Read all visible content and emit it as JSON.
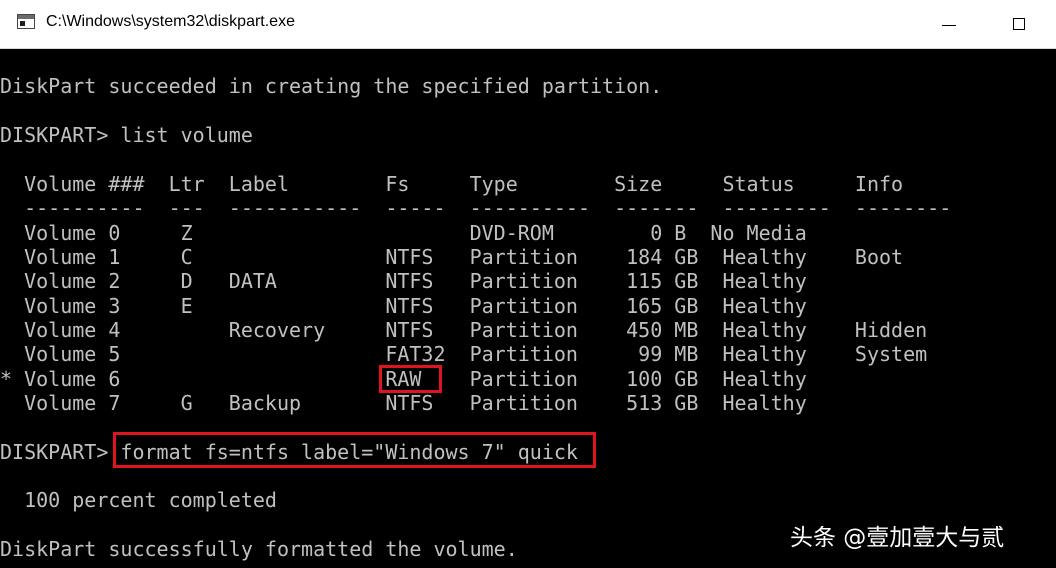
{
  "window": {
    "title": "C:\\Windows\\system32\\diskpart.exe",
    "icon": "console-window-icon"
  },
  "console": {
    "lines": [
      "DiskPart succeeded in creating the specified partition.",
      "DISKPART> list volume",
      "  Volume ###  Ltr  Label        Fs     Type        Size     Status     Info",
      "  ----------  ---  -----------  -----  ----------  -------  ---------  --------",
      "  Volume 0     Z                       DVD-ROM        0 B  No Media",
      "  Volume 1     C                NTFS   Partition    184 GB  Healthy    Boot",
      "  Volume 2     D   DATA         NTFS   Partition    115 GB  Healthy",
      "  Volume 3     E                NTFS   Partition    165 GB  Healthy",
      "  Volume 4         Recovery     NTFS   Partition    450 MB  Healthy    Hidden",
      "  Volume 5                      FAT32  Partition     99 MB  Healthy    System",
      "* Volume 6                      RAW    Partition    100 GB  Healthy",
      "  Volume 7     G   Backup       NTFS   Partition    513 GB  Healthy",
      "DISKPART> format fs=ntfs label=\"Windows 7\" quick",
      "  100 percent completed",
      "DiskPart successfully formatted the volume."
    ]
  },
  "watermark": "头条 @壹加壹大与贰",
  "colors": {
    "background": "#000000",
    "text": "#c0c0c0",
    "highlight": "#e0141e"
  }
}
